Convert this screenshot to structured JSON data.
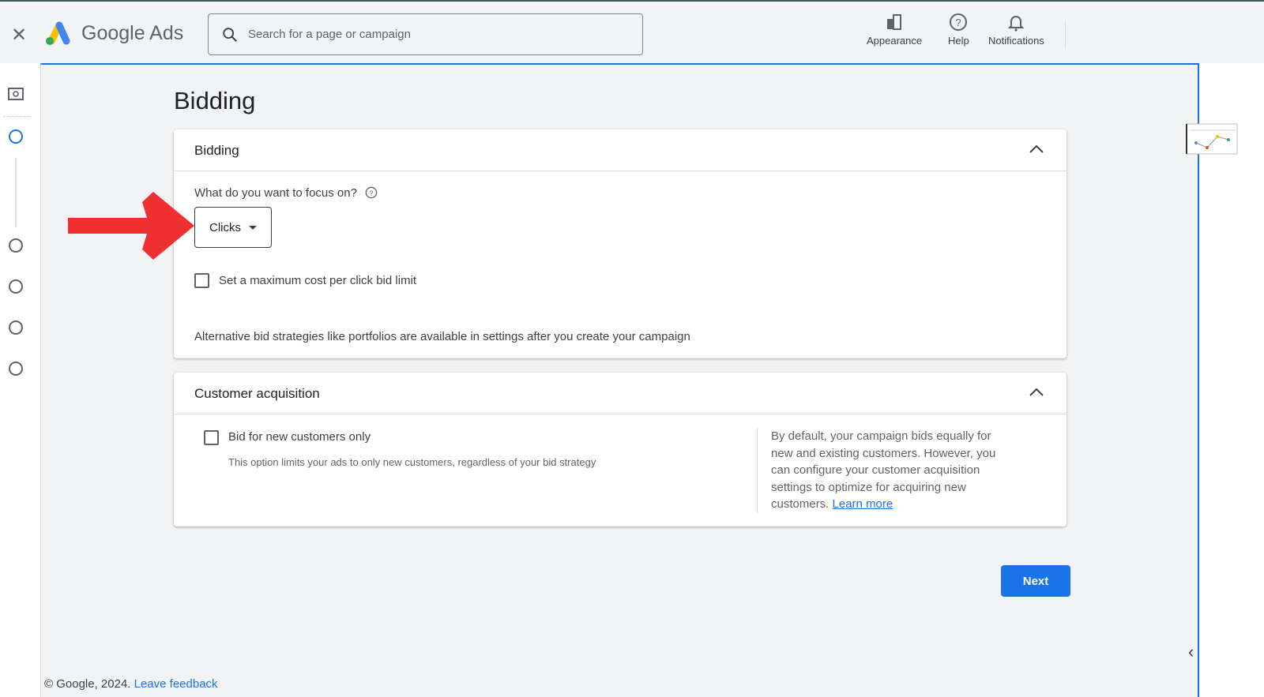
{
  "header": {
    "brand": "Google Ads",
    "search_placeholder": "Search for a page or campaign",
    "appearance": "Appearance",
    "help": "Help",
    "notifications": "Notifications"
  },
  "page": {
    "title": "Bidding"
  },
  "bidding": {
    "title": "Bidding",
    "focus_label": "What do you want to focus on?",
    "focus_value": "Clicks",
    "max_cpc_label": "Set a maximum cost per click bid limit",
    "max_cpc_checked": false,
    "note": "Alternative bid strategies like portfolios are available in settings after you create your campaign"
  },
  "customer": {
    "title": "Customer acquisition",
    "new_only_label": "Bid for new customers only",
    "new_only_checked": false,
    "new_only_desc": "This option limits your ads to only new customers, regardless of your bid strategy",
    "info": "By default, your campaign bids equally for new and existing customers. However, you can configure your customer acquisition settings to optimize for acquiring new customers.",
    "learn_more": "Learn more"
  },
  "actions": {
    "next": "Next"
  },
  "footer": {
    "copyright": "© Google, 2024.",
    "feedback": "Leave feedback"
  },
  "colors": {
    "accent": "#1a73e8",
    "arrow": "#f03030"
  }
}
